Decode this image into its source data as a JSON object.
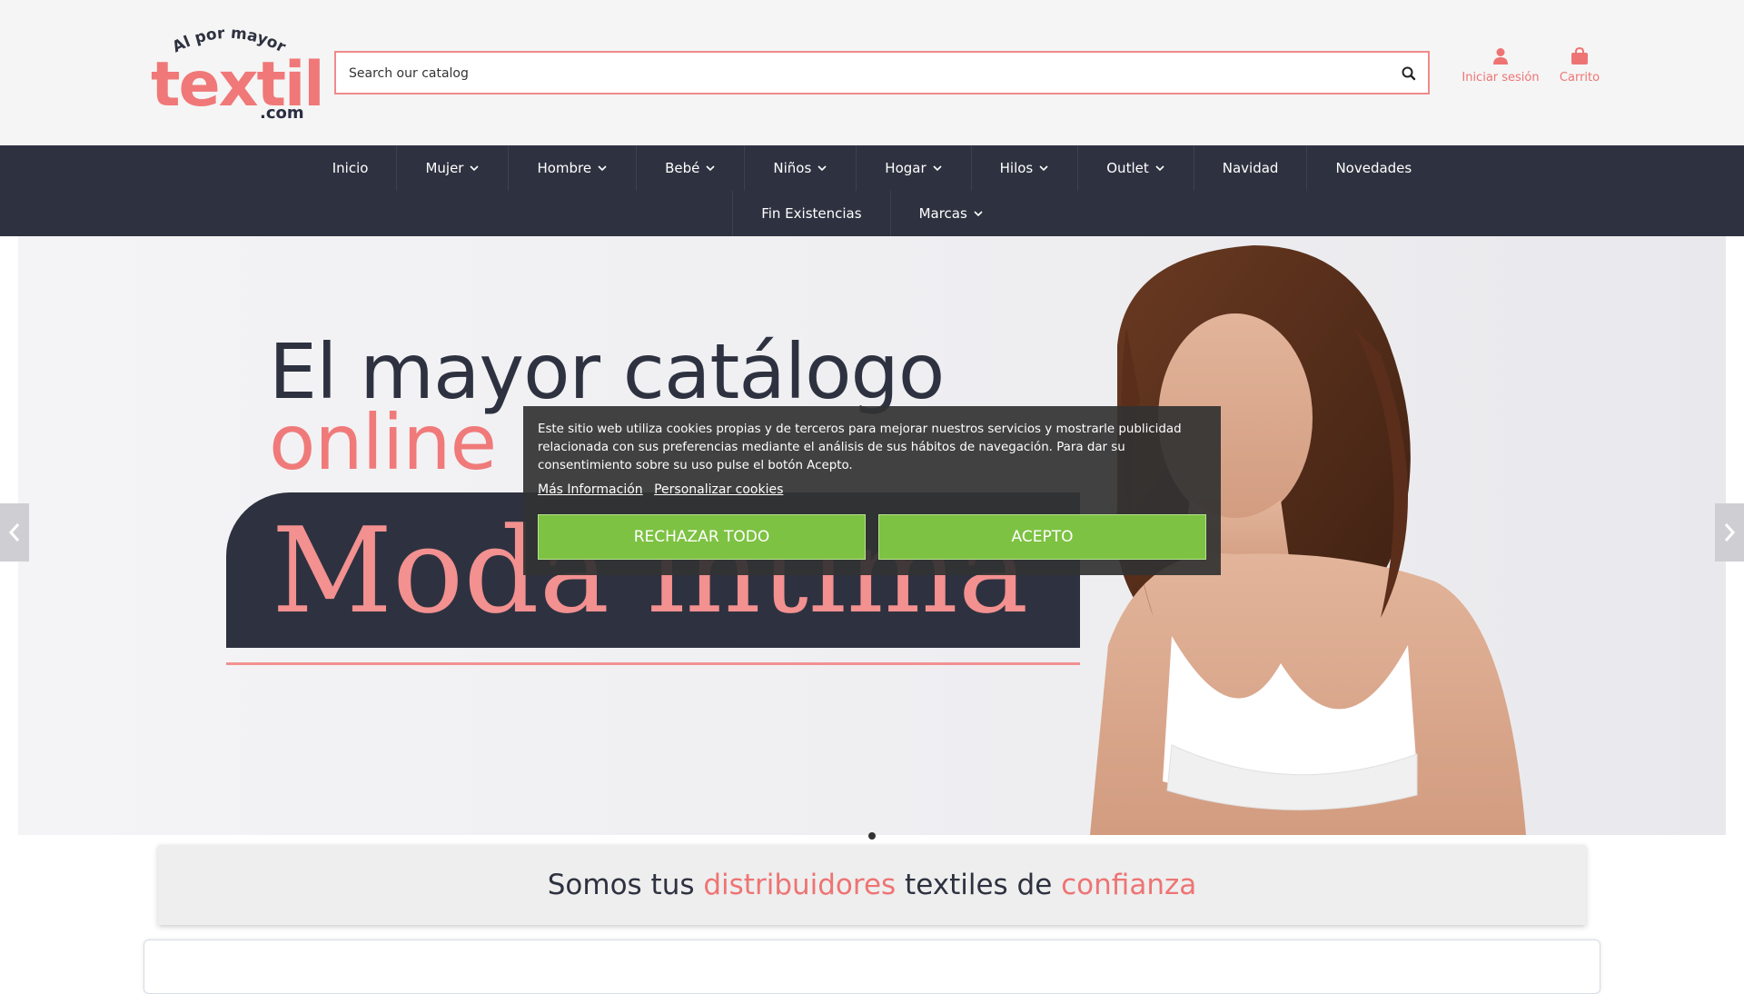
{
  "brand": {
    "logo_top": "Al por mayor",
    "logo_main": "textil",
    "logo_suffix": ".com"
  },
  "search": {
    "placeholder": "Search our catalog"
  },
  "header_links": {
    "login": "Iniciar sesión",
    "cart": "Carrito"
  },
  "nav": {
    "row1": [
      {
        "label": "Inicio",
        "dropdown": false
      },
      {
        "label": "Mujer",
        "dropdown": true
      },
      {
        "label": "Hombre",
        "dropdown": true
      },
      {
        "label": "Bebé",
        "dropdown": true
      },
      {
        "label": "Niños",
        "dropdown": true
      },
      {
        "label": "Hogar",
        "dropdown": true
      },
      {
        "label": "Hilos",
        "dropdown": true
      },
      {
        "label": "Outlet",
        "dropdown": true
      },
      {
        "label": "Navidad",
        "dropdown": false
      },
      {
        "label": "Novedades",
        "dropdown": false
      }
    ],
    "row2": [
      {
        "label": "Fin Existencias",
        "dropdown": false
      },
      {
        "label": "Marcas",
        "dropdown": true
      }
    ]
  },
  "hero": {
    "line1": "El mayor catálogo",
    "line2": "online",
    "band": "Moda íntima"
  },
  "cookie": {
    "text": "Este sitio web utiliza cookies propias y de terceros para mejorar nuestros servicios y mostrarle publicidad relacionada con sus preferencias mediante el análisis de sus hábitos de navegación. Para dar su consentimiento sobre su uso pulse el botón Acepto.",
    "link_more": "Más Información",
    "link_custom": "Personalizar cookies",
    "btn_reject": "RECHAZAR TODO",
    "btn_accept": "ACEPTO"
  },
  "tagline": {
    "p1": "Somos tus ",
    "p2": "distribuidores",
    "p3": " textiles de ",
    "p4": "confianza"
  },
  "colors": {
    "accent": "#ee7474",
    "nav_bg": "#2e3240",
    "button_green": "#7dc242"
  }
}
